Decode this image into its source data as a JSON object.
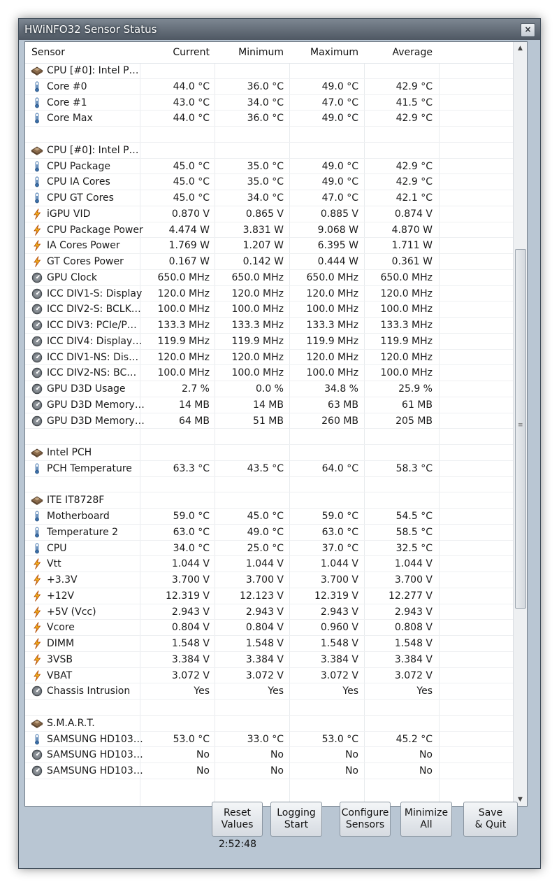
{
  "window": {
    "title": "HWiNFO32 Sensor Status",
    "close_label": "×"
  },
  "columns": [
    "Sensor",
    "Current",
    "Minimum",
    "Maximum",
    "Average"
  ],
  "rows": [
    {
      "type": "group",
      "name": "CPU [#0]: Intel P…"
    },
    {
      "type": "temp",
      "name": "Core #0",
      "cur": "44.0 °C",
      "min": "36.0 °C",
      "max": "49.0 °C",
      "avg": "42.9 °C"
    },
    {
      "type": "temp",
      "name": "Core #1",
      "cur": "43.0 °C",
      "min": "34.0 °C",
      "max": "47.0 °C",
      "avg": "41.5 °C"
    },
    {
      "type": "temp",
      "name": "Core Max",
      "cur": "44.0 °C",
      "min": "36.0 °C",
      "max": "49.0 °C",
      "avg": "42.9 °C"
    },
    {
      "type": "blank"
    },
    {
      "type": "group",
      "name": "CPU [#0]: Intel P…"
    },
    {
      "type": "temp",
      "name": "CPU Package",
      "cur": "45.0 °C",
      "min": "35.0 °C",
      "max": "49.0 °C",
      "avg": "42.9 °C"
    },
    {
      "type": "temp",
      "name": "CPU IA Cores",
      "cur": "45.0 °C",
      "min": "35.0 °C",
      "max": "49.0 °C",
      "avg": "42.9 °C"
    },
    {
      "type": "temp",
      "name": "CPU GT Cores",
      "cur": "45.0 °C",
      "min": "34.0 °C",
      "max": "47.0 °C",
      "avg": "42.1 °C"
    },
    {
      "type": "volt",
      "name": "iGPU VID",
      "cur": "0.870 V",
      "min": "0.865 V",
      "max": "0.885 V",
      "avg": "0.874 V"
    },
    {
      "type": "volt",
      "name": "CPU Package Power",
      "cur": "4.474 W",
      "min": "3.831 W",
      "max": "9.068 W",
      "avg": "4.870 W"
    },
    {
      "type": "volt",
      "name": "IA Cores Power",
      "cur": "1.769 W",
      "min": "1.207 W",
      "max": "6.395 W",
      "avg": "1.711 W"
    },
    {
      "type": "volt",
      "name": "GT Cores Power",
      "cur": "0.167 W",
      "min": "0.142 W",
      "max": "0.444 W",
      "avg": "0.361 W"
    },
    {
      "type": "other",
      "name": "GPU Clock",
      "cur": "650.0 MHz",
      "min": "650.0 MHz",
      "max": "650.0 MHz",
      "avg": "650.0 MHz"
    },
    {
      "type": "other",
      "name": "ICC DIV1-S: Display",
      "cur": "120.0 MHz",
      "min": "120.0 MHz",
      "max": "120.0 MHz",
      "avg": "120.0 MHz"
    },
    {
      "type": "other",
      "name": "ICC DIV2-S: BCLK…",
      "cur": "100.0 MHz",
      "min": "100.0 MHz",
      "max": "100.0 MHz",
      "avg": "100.0 MHz"
    },
    {
      "type": "other",
      "name": "ICC DIV3: PCIe/P…",
      "cur": "133.3 MHz",
      "min": "133.3 MHz",
      "max": "133.3 MHz",
      "avg": "133.3 MHz"
    },
    {
      "type": "other",
      "name": "ICC DIV4: Display…",
      "cur": "119.9 MHz",
      "min": "119.9 MHz",
      "max": "119.9 MHz",
      "avg": "119.9 MHz"
    },
    {
      "type": "other",
      "name": "ICC DIV1-NS: Dis…",
      "cur": "120.0 MHz",
      "min": "120.0 MHz",
      "max": "120.0 MHz",
      "avg": "120.0 MHz"
    },
    {
      "type": "other",
      "name": "ICC DIV2-NS: BC…",
      "cur": "100.0 MHz",
      "min": "100.0 MHz",
      "max": "100.0 MHz",
      "avg": "100.0 MHz"
    },
    {
      "type": "other",
      "name": "GPU D3D Usage",
      "cur": "2.7 %",
      "min": "0.0 %",
      "max": "34.8 %",
      "avg": "25.9 %"
    },
    {
      "type": "other",
      "name": "GPU D3D Memory…",
      "cur": "14 MB",
      "min": "14 MB",
      "max": "63 MB",
      "avg": "61 MB"
    },
    {
      "type": "other",
      "name": "GPU D3D Memory…",
      "cur": "64 MB",
      "min": "51 MB",
      "max": "260 MB",
      "avg": "205 MB"
    },
    {
      "type": "blank"
    },
    {
      "type": "group",
      "name": "Intel PCH"
    },
    {
      "type": "temp",
      "name": "PCH Temperature",
      "cur": "63.3 °C",
      "min": "43.5 °C",
      "max": "64.0 °C",
      "avg": "58.3 °C"
    },
    {
      "type": "blank"
    },
    {
      "type": "group",
      "name": "ITE IT8728F"
    },
    {
      "type": "temp",
      "name": "Motherboard",
      "cur": "59.0 °C",
      "min": "45.0 °C",
      "max": "59.0 °C",
      "avg": "54.5 °C"
    },
    {
      "type": "temp",
      "name": "Temperature 2",
      "cur": "63.0 °C",
      "min": "49.0 °C",
      "max": "63.0 °C",
      "avg": "58.5 °C"
    },
    {
      "type": "temp",
      "name": "CPU",
      "cur": "34.0 °C",
      "min": "25.0 °C",
      "max": "37.0 °C",
      "avg": "32.5 °C"
    },
    {
      "type": "volt",
      "name": "Vtt",
      "cur": "1.044 V",
      "min": "1.044 V",
      "max": "1.044 V",
      "avg": "1.044 V"
    },
    {
      "type": "volt",
      "name": "+3.3V",
      "cur": "3.700 V",
      "min": "3.700 V",
      "max": "3.700 V",
      "avg": "3.700 V"
    },
    {
      "type": "volt",
      "name": "+12V",
      "cur": "12.319 V",
      "min": "12.123 V",
      "max": "12.319 V",
      "avg": "12.277 V"
    },
    {
      "type": "volt",
      "name": "+5V (Vcc)",
      "cur": "2.943 V",
      "min": "2.943 V",
      "max": "2.943 V",
      "avg": "2.943 V"
    },
    {
      "type": "volt",
      "name": "Vcore",
      "cur": "0.804 V",
      "min": "0.804 V",
      "max": "0.960 V",
      "avg": "0.808 V"
    },
    {
      "type": "volt",
      "name": "DIMM",
      "cur": "1.548 V",
      "min": "1.548 V",
      "max": "1.548 V",
      "avg": "1.548 V"
    },
    {
      "type": "volt",
      "name": "3VSB",
      "cur": "3.384 V",
      "min": "3.384 V",
      "max": "3.384 V",
      "avg": "3.384 V"
    },
    {
      "type": "volt",
      "name": "VBAT",
      "cur": "3.072 V",
      "min": "3.072 V",
      "max": "3.072 V",
      "avg": "3.072 V"
    },
    {
      "type": "other",
      "name": "Chassis Intrusion",
      "cur": "Yes",
      "min": "Yes",
      "max": "Yes",
      "avg": "Yes"
    },
    {
      "type": "blank"
    },
    {
      "type": "group",
      "name": "S.M.A.R.T."
    },
    {
      "type": "temp",
      "name": "SAMSUNG HD103…",
      "cur": "53.0 °C",
      "min": "33.0 °C",
      "max": "53.0 °C",
      "avg": "45.2 °C"
    },
    {
      "type": "other",
      "name": "SAMSUNG HD103…",
      "cur": "No",
      "min": "No",
      "max": "No",
      "avg": "No"
    },
    {
      "type": "other",
      "name": "SAMSUNG HD103…",
      "cur": "No",
      "min": "No",
      "max": "No",
      "avg": "No"
    }
  ],
  "buttons": {
    "reset": [
      "Reset",
      "Values"
    ],
    "logging": [
      "Logging",
      "Start"
    ],
    "configure": [
      "Configure",
      "Sensors"
    ],
    "minimize": [
      "Minimize",
      "All"
    ],
    "save": [
      "Save",
      "& Quit"
    ]
  },
  "timer": "2:52:48",
  "scrollbar": {
    "up": "▲",
    "down": "▼",
    "grip": "≡"
  },
  "icons": {
    "group": "chip-icon",
    "temp": "thermometer-icon",
    "volt": "lightning-icon",
    "other": "gauge-icon"
  }
}
